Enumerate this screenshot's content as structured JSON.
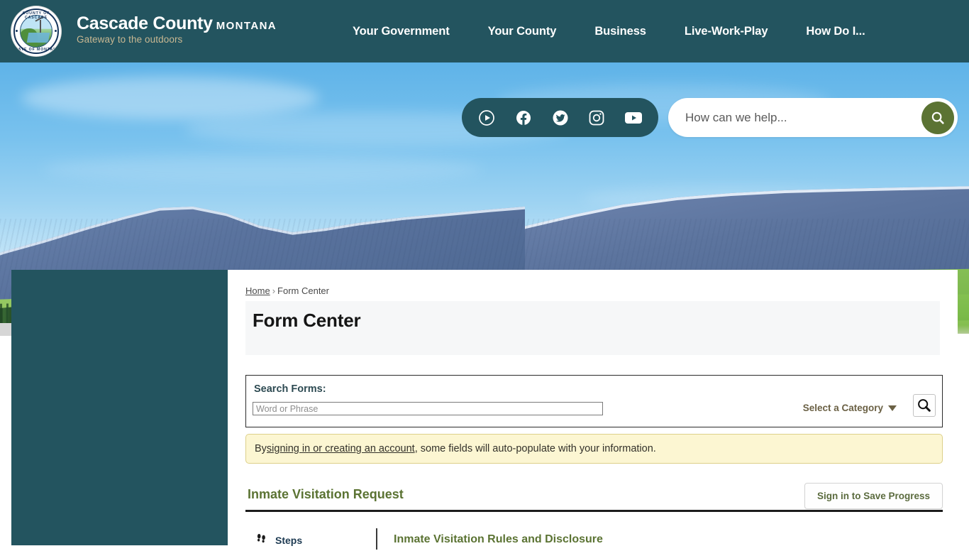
{
  "header": {
    "logo_alt": "County of Cascade State of Montana seal",
    "seal_text_top": "COUNTY OF CASCADE",
    "seal_text_bottom": "STATE OF MONTANA",
    "brand_name": "Cascade County",
    "brand_state": "MONTANA",
    "tagline": "Gateway to the outdoors",
    "background_color": "#23545f",
    "nav": [
      {
        "label": "Your Government"
      },
      {
        "label": "Your County"
      },
      {
        "label": "Business"
      },
      {
        "label": "Live-Work-Play"
      },
      {
        "label": "How Do I..."
      }
    ]
  },
  "hero": {
    "social": [
      {
        "name": "video-play-icon"
      },
      {
        "name": "facebook-icon"
      },
      {
        "name": "twitter-icon"
      },
      {
        "name": "instagram-icon"
      },
      {
        "name": "youtube-icon"
      }
    ],
    "search_placeholder": "How can we help...",
    "search_value": "",
    "search_button_icon": "search-icon",
    "search_button_color": "#5b7333"
  },
  "breadcrumb": {
    "home": "Home",
    "separator": "›",
    "current": "Form Center"
  },
  "page": {
    "title": "Form Center"
  },
  "search_forms": {
    "label": "Search Forms:",
    "input_placeholder": "Word or Phrase",
    "input_value": "",
    "category_label": "Select a Category",
    "category_caret": "chevron-down-icon",
    "search_button_icon": "search-icon"
  },
  "notice": {
    "prefix": "By ",
    "link": "signing in or creating an account",
    "suffix": ", some fields will auto-populate with your information.",
    "background_color": "#fcf6d2",
    "border_color": "#ddd08a"
  },
  "form": {
    "name": "Inmate Visitation Request",
    "save_button": "Sign in to Save Progress",
    "accent_color": "#5b7333"
  },
  "steps": {
    "icon": "footprints-icon",
    "label": "Steps",
    "current_step_title": "Inmate Visitation Rules and Disclosure"
  }
}
